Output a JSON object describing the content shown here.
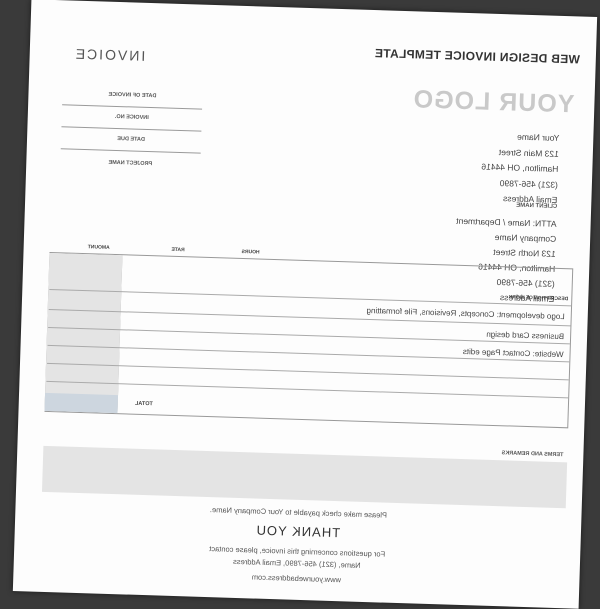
{
  "header": {
    "doc_title": "WEB DESIGN INVOICE TEMPLATE",
    "logo": "YOUR LOGO",
    "invoice_word": "INVOICE"
  },
  "meta": {
    "date_label": "DATE OF INVOICE",
    "number_label": "INVOICE NO.",
    "due_label": "DATE DUE",
    "project_label": "PROJECT NAME"
  },
  "from": {
    "name": "Your Name",
    "street": "123 Main Street",
    "city": "Hamilton, OH 44416",
    "phone": "(321) 456-7890",
    "email": "Email Address"
  },
  "client": {
    "label": "CLIENT NAME",
    "attn": "ATTN: Name / Department",
    "company": "Company Name",
    "street": "123 North Street",
    "city": "Hamilton, OH 44416",
    "phone": "(321) 456-7890",
    "email": "Email Address"
  },
  "table": {
    "headers": {
      "description": "DESCRIPTION OF WORK",
      "hours": "HOURS",
      "rate": "RATE",
      "amount": "AMOUNT"
    },
    "rows": [
      "Logo development: Concepts, Revisions, File formatting",
      "Business Card design",
      "Website: Contact Page edits"
    ],
    "total_label": "TOTAL"
  },
  "terms": {
    "label": "TERMS AND REMARKS"
  },
  "footer": {
    "payable": "Please make check payable to Your Company Name.",
    "thanks": "THANK YOU",
    "questions": "For questions concerning this invoice, please contact",
    "contact": "Name, (321) 456-7890, Email Address",
    "website": "www.yourwebaddress.com"
  }
}
